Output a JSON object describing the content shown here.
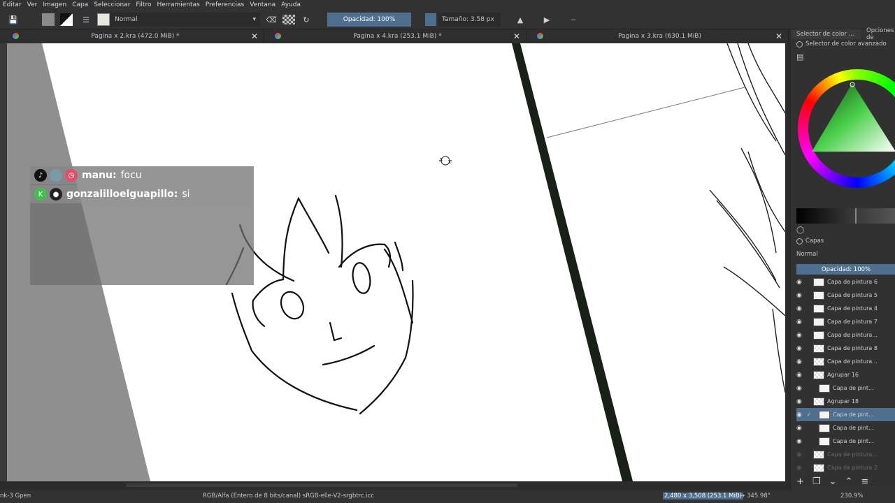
{
  "menubar": [
    "Editar",
    "Ver",
    "Imagen",
    "Capa",
    "Seleccionar",
    "Filtro",
    "Herramientas",
    "Preferencias",
    "Ventana",
    "Ayuda"
  ],
  "toolbar": {
    "blend_mode": "Normal",
    "opacity_label": "Opacidad: 100%",
    "size_label": "Tamaño: 3.58 px"
  },
  "tabs": [
    {
      "title": "Pagina x 2.kra (472.0 MiB) *"
    },
    {
      "title": "Pagina x 4.kra (253.1 MiB) *"
    },
    {
      "title": "Pagina x 3.kra (630.1 MiB)"
    }
  ],
  "chat": [
    {
      "user": "manu:",
      "message": "focu"
    },
    {
      "user": "gonzalilloelguapillo:",
      "message": "si"
    }
  ],
  "docker": {
    "tab1": "Selector de color ...",
    "tab2": "Opciones de",
    "color_header": "Selector de color avanzado",
    "layers_header": "Capas",
    "layers_blend": "Normal",
    "layers_opacity": "Opacidad:  100%"
  },
  "layers": [
    {
      "name": "Capa de pintura 6",
      "thumb": "plain",
      "indent": 0,
      "selected": false,
      "dim": false
    },
    {
      "name": "Capa de pintura 5",
      "thumb": "plain",
      "indent": 0,
      "selected": false,
      "dim": false
    },
    {
      "name": "Capa de pintura 4",
      "thumb": "plain",
      "indent": 0,
      "selected": false,
      "dim": false
    },
    {
      "name": "Capa de pintura 7",
      "thumb": "plain",
      "indent": 0,
      "selected": false,
      "dim": false
    },
    {
      "name": "Capa de pintura...",
      "thumb": "plain",
      "indent": 0,
      "selected": false,
      "dim": false
    },
    {
      "name": "Capa de pintura 8",
      "thumb": "checker",
      "indent": 0,
      "selected": false,
      "dim": false
    },
    {
      "name": "Capa de pintura...",
      "thumb": "checker",
      "indent": 0,
      "selected": false,
      "dim": false
    },
    {
      "name": "Agrupar 16",
      "thumb": "checker",
      "indent": 0,
      "selected": false,
      "dim": false
    },
    {
      "name": "Capa de pint...",
      "thumb": "plain",
      "indent": 1,
      "selected": false,
      "dim": false
    },
    {
      "name": "Agrupar 18",
      "thumb": "checker",
      "indent": 0,
      "selected": false,
      "dim": false
    },
    {
      "name": "Capa de pint...",
      "thumb": "plain",
      "indent": 1,
      "selected": true,
      "dim": false
    },
    {
      "name": "Capa de pint...",
      "thumb": "plain",
      "indent": 1,
      "selected": false,
      "dim": false
    },
    {
      "name": "Capa de pint...",
      "thumb": "plain",
      "indent": 1,
      "selected": false,
      "dim": false
    },
    {
      "name": "Capa de pintura...",
      "thumb": "checker",
      "indent": 0,
      "selected": false,
      "dim": true
    },
    {
      "name": "Capa de pintura 2",
      "thumb": "checker",
      "indent": 0,
      "selected": false,
      "dim": true
    }
  ],
  "status": {
    "brush": "nk-3 Gpen",
    "color_space": "RGB/Alfa (Entero de 8 bits/canal)  sRGB-elle-V2-srgbtrc.icc",
    "dimensions": "2,480 x 3,508 (253.1 MiB)",
    "rotation": "345.98°",
    "zoom": "230.9%"
  }
}
